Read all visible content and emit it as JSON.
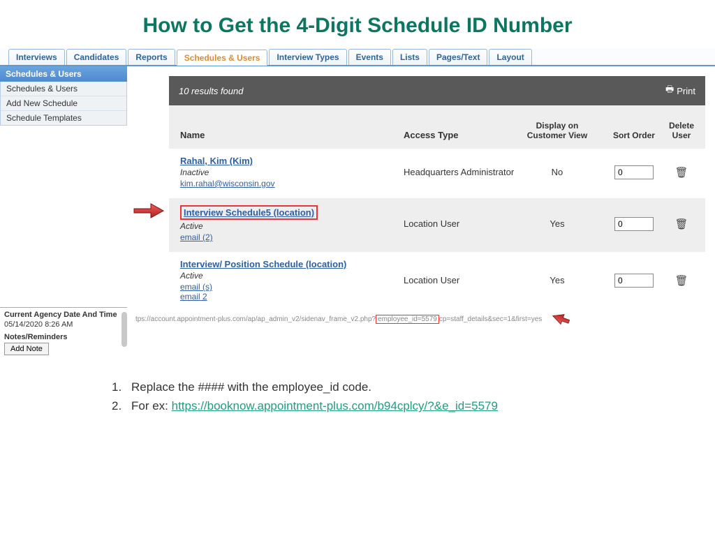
{
  "title": "How to Get the 4-Digit Schedule ID Number",
  "tabs": [
    "Interviews",
    "Candidates",
    "Reports",
    "Schedules & Users",
    "Interview Types",
    "Events",
    "Lists",
    "Pages/Text",
    "Layout"
  ],
  "active_tab_index": 3,
  "sidebar": {
    "header": "Schedules & Users",
    "items": [
      "Schedules & Users",
      "Add New Schedule",
      "Schedule Templates"
    ],
    "meta": {
      "header": "Current Agency Date And Time",
      "datetime": "05/14/2020 8:26 AM",
      "notes_header": "Notes/Reminders",
      "add_note": "Add Note"
    }
  },
  "results_bar": {
    "text": "10 results found",
    "print": "Print"
  },
  "columns": {
    "c1": "Name",
    "c2": "Access Type",
    "c3": "Display on Customer View",
    "c4": "Sort Order",
    "c5": "Delete User"
  },
  "rows": [
    {
      "name": "Rahal, Kim (Kim)",
      "status": "Inactive",
      "emails": [
        "kim.rahal@wisconsin.gov"
      ],
      "access": "Headquarters Administrator",
      "display": "No",
      "sort": "0",
      "highlight": false
    },
    {
      "name": "Interview Schedule5 (location)",
      "status": "Active",
      "emails": [
        "email (2)"
      ],
      "access": "Location User",
      "display": "Yes",
      "sort": "0",
      "highlight": true
    },
    {
      "name": "Interview/ Position Schedule (location)",
      "status": "Active",
      "emails": [
        "email (s)",
        "email 2"
      ],
      "access": "Location User",
      "display": "Yes",
      "sort": "0",
      "highlight": false
    }
  ],
  "url_bar": {
    "pre": "tps://account.appointment-plus.com/ap/ap_admin_v2/sidenav_frame_v2.php?",
    "highlight": "employee_id=5579",
    "post": "cp=staff_details&sec=1&first=yes"
  },
  "instructions": {
    "i1": "Replace the #### with the employee_id code.",
    "i2_pre": "For ex: ",
    "i2_link": "https://booknow.appointment-plus.com/b94cplcy/?&e_id=5579"
  }
}
